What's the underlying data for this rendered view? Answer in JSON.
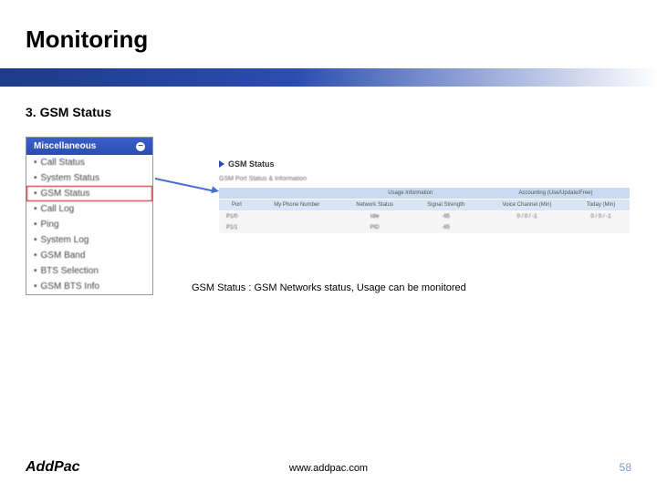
{
  "header": {
    "title": "Monitoring",
    "section": "3. GSM Status"
  },
  "sidebar": {
    "title": "Miscellaneous",
    "items": [
      {
        "label": "Call Status"
      },
      {
        "label": "System Status"
      },
      {
        "label": "GSM Status"
      },
      {
        "label": "Call Log"
      },
      {
        "label": "Ping"
      },
      {
        "label": "System Log"
      },
      {
        "label": "GSM Band"
      },
      {
        "label": "BTS Selection"
      },
      {
        "label": "GSM BTS Info"
      }
    ]
  },
  "panel": {
    "title": "GSM Status",
    "subtitle": "GSM Port Status & Information",
    "group_headers": {
      "g1": "",
      "g2": "Usage Information",
      "g3": "Accounting (Use/Update/Free)"
    },
    "columns": {
      "c1": "Port",
      "c2": "My Phone Number",
      "c3": "Network Status",
      "c4": "Signal Strength",
      "c5": "Voice Channel (Min)",
      "c6": "Today (Min)"
    },
    "rows": [
      {
        "port": "P1/0",
        "num": "",
        "status": "Idle",
        "signal": "-65",
        "voice": "0 / 0 / -1",
        "today": "0 / 0 / -1"
      },
      {
        "port": "P1/1",
        "num": "",
        "status": "PID",
        "signal": "-65",
        "voice": "",
        "today": ""
      }
    ]
  },
  "caption": "GSM Status : GSM Networks status, Usage can be monitored",
  "footer": {
    "logo": "AddPac",
    "url": "www.addpac.com",
    "page": "58"
  }
}
